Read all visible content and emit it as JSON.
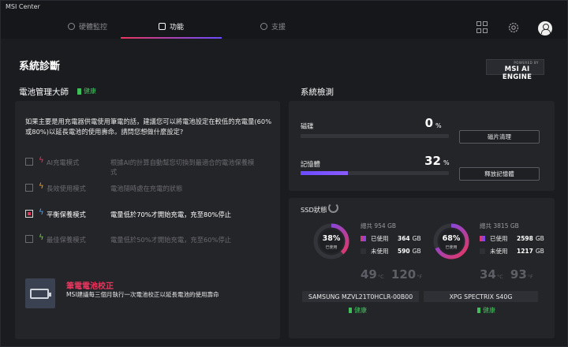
{
  "window": {
    "title": "MSI Center"
  },
  "nav": {
    "tabs": [
      {
        "label": "硬體監控"
      },
      {
        "label": "功能"
      },
      {
        "label": "支援"
      }
    ]
  },
  "page": {
    "title": "系統診斷"
  },
  "ai_engine": {
    "powered_by": "POWERED BY",
    "name": "MSI AI ENGINE"
  },
  "battery": {
    "title": "電池管理大師",
    "health": "健康",
    "description": "如果主要是用充電器供電使用筆電的話，建議您可以將電池設定在較低的充電量(60%或80%)以延長電池的使用壽命。請問您想做什麼設定?",
    "modes": [
      {
        "name": "AI充電模式",
        "desc": "根據AI的計算自動幫您切換到最適合的電池保養模式",
        "checked": false,
        "bolt_color": "#e8365e"
      },
      {
        "name": "長效使用模式",
        "desc": "電池隨時處在充電的狀態",
        "checked": false,
        "bolt_color": "#f0a030"
      },
      {
        "name": "平衡保養模式",
        "desc": "電量低於70%才開始充電，充至80%停止",
        "checked": true,
        "bolt_color": "#4aa8ff"
      },
      {
        "name": "最佳保養模式",
        "desc": "電量低於50%才開始充電，充至60%停止",
        "checked": false,
        "bolt_color": "#7ad04a"
      }
    ],
    "calibration": {
      "title": "筆電電池校正",
      "desc": "MSI建議每三個月執行一次電池校正以延長電池的使用壽命"
    }
  },
  "system": {
    "title": "系統檢測",
    "disk": {
      "label": "磁碟",
      "value": 0,
      "unit": "%",
      "button": "磁片清理"
    },
    "memory": {
      "label": "記憶體",
      "value": 32,
      "unit": "%",
      "button": "釋放記憶體"
    }
  },
  "ssd": {
    "title": "SSD狀態",
    "total_label": "總共",
    "used_label": "已使用",
    "free_label": "未使用",
    "ring_label": "已使用",
    "drives": [
      {
        "name": "SAMSUNG MZVL21T0HCLR-00B00",
        "total": "954 GB",
        "used": "364",
        "free": "590",
        "unit": "GB",
        "pct": 38,
        "pct_text": "38%",
        "temp_c": "49",
        "temp_f": "120",
        "health": "健康"
      },
      {
        "name": "XPG SPECTRIX S40G",
        "total": "3815 GB",
        "used": "2598",
        "free": "1217",
        "unit": "GB",
        "pct": 68,
        "pct_text": "68%",
        "temp_c": "34",
        "temp_f": "93",
        "health": "健康"
      }
    ],
    "unit_c": "°C",
    "unit_f": "°F"
  },
  "colors": {
    "accent_red": "#e8365e",
    "accent_purple": "#6b4cff",
    "healthy": "#3fbf5a",
    "bg": "#1b1c20",
    "panel": "#242529"
  }
}
